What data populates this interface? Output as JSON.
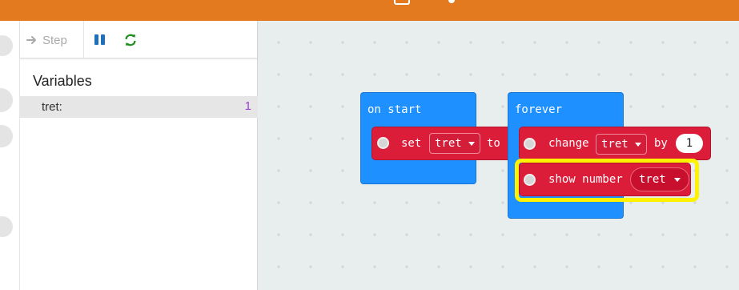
{
  "toolbar": {
    "step_label": "Step",
    "step_icon": "arrow-right-icon",
    "pause_icon": "pause-icon",
    "restart_icon": "restart-icon"
  },
  "variables_panel": {
    "title": "Variables",
    "items": [
      {
        "name": "tret:",
        "value": "1"
      }
    ]
  },
  "workspace": {
    "on_start": {
      "label": "on start",
      "set_keyword": "set",
      "variable": "tret",
      "to_keyword": "to"
    },
    "forever": {
      "label": "forever",
      "change_keyword": "change",
      "change_variable": "tret",
      "by_keyword": "by",
      "by_value": "1",
      "show_number_label": "show number",
      "show_variable": "tret"
    }
  },
  "colors": {
    "header": "#e37a20",
    "event_block": "#1e90ff",
    "variable_block": "#dc1d3a",
    "highlight": "#fff200",
    "variable_value": "#9b3fd1"
  }
}
